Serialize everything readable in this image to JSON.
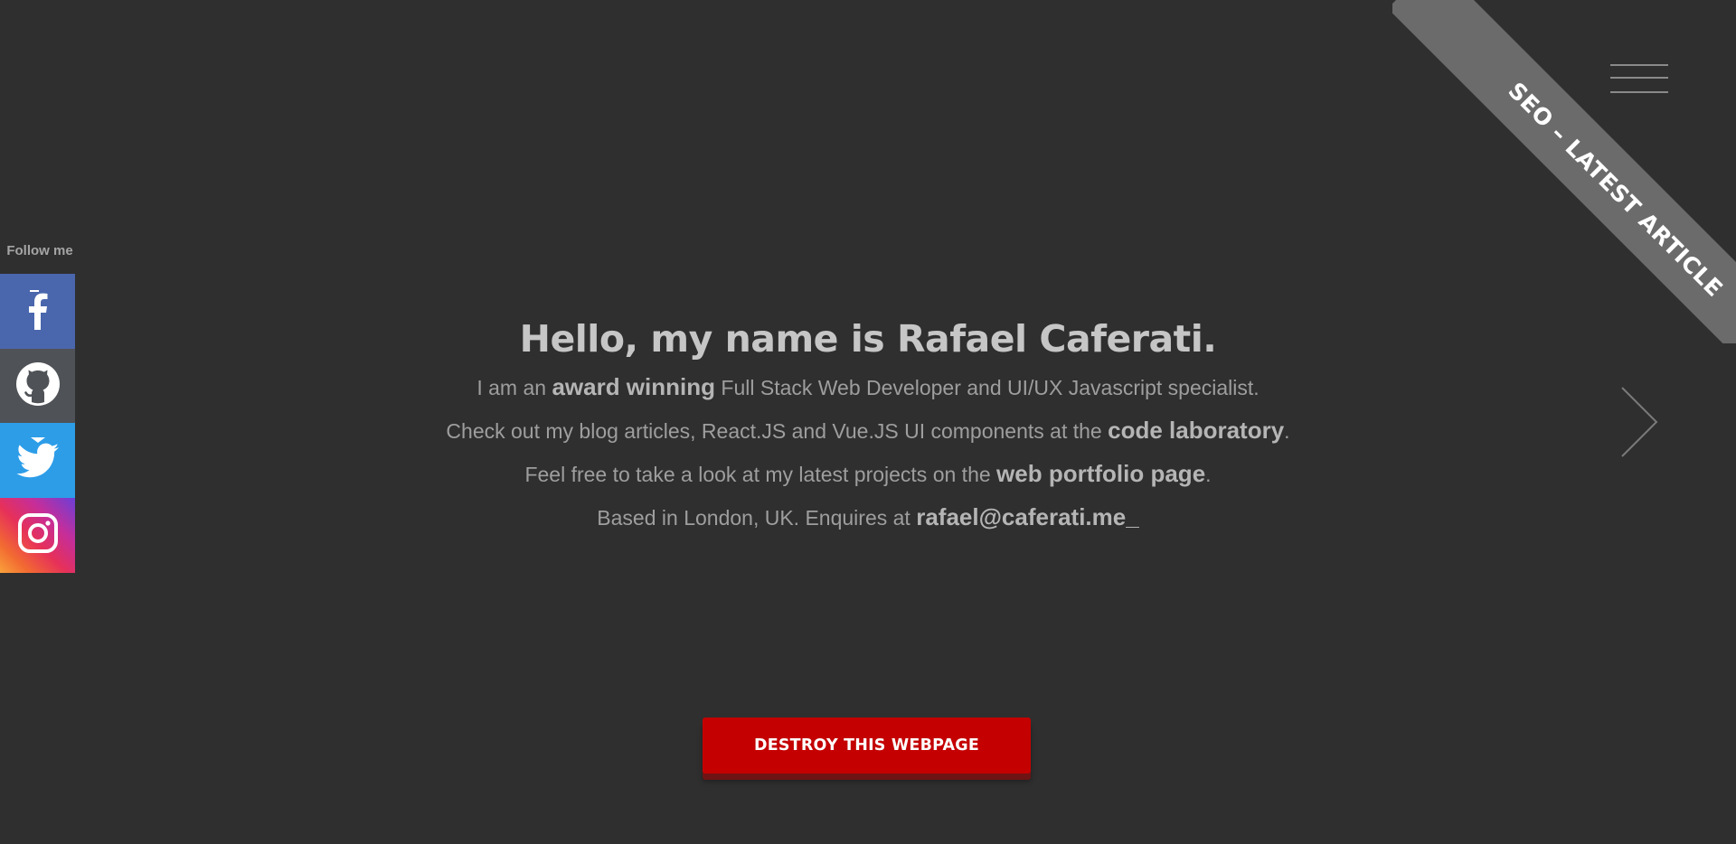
{
  "ribbon": {
    "label": "SEO – LATEST ARTICLE"
  },
  "menu": {
    "icon": "hamburger-menu-icon"
  },
  "navigation": {
    "next_icon": "chevron-right-icon"
  },
  "social": {
    "follow_label": "Follow me",
    "items": [
      {
        "name": "Facebook",
        "icon": "facebook-icon",
        "color": "#4a67ad"
      },
      {
        "name": "GitHub",
        "icon": "github-icon",
        "color": "#4f5257"
      },
      {
        "name": "Twitter",
        "icon": "twitter-icon",
        "color": "#2d9de8"
      },
      {
        "name": "Instagram",
        "icon": "instagram-icon",
        "color": "#e6305a"
      }
    ]
  },
  "hero": {
    "title": "Hello, my name is Rafael Caferati.",
    "line1": {
      "pre": "I am an ",
      "strong": "award winning",
      "post": " Full Stack Web Developer and UI/UX Javascript specialist."
    },
    "line2": {
      "pre": "Check out my blog articles, React.JS and Vue.JS UI components at the ",
      "strong": "code laboratory",
      "post": "."
    },
    "line3": {
      "pre": "Feel free to take a look at my latest projects on the ",
      "strong": "web portfolio page",
      "post": "."
    },
    "line4": {
      "pre": "Based in London, UK. Enquires at ",
      "strong": "rafael@caferati.me_"
    }
  },
  "cta": {
    "destroy_label": "DESTROY THIS WEBPAGE",
    "color": "#c40001"
  },
  "colors": {
    "background": "#2f2f2f",
    "ribbon": "#6b6b6b"
  }
}
